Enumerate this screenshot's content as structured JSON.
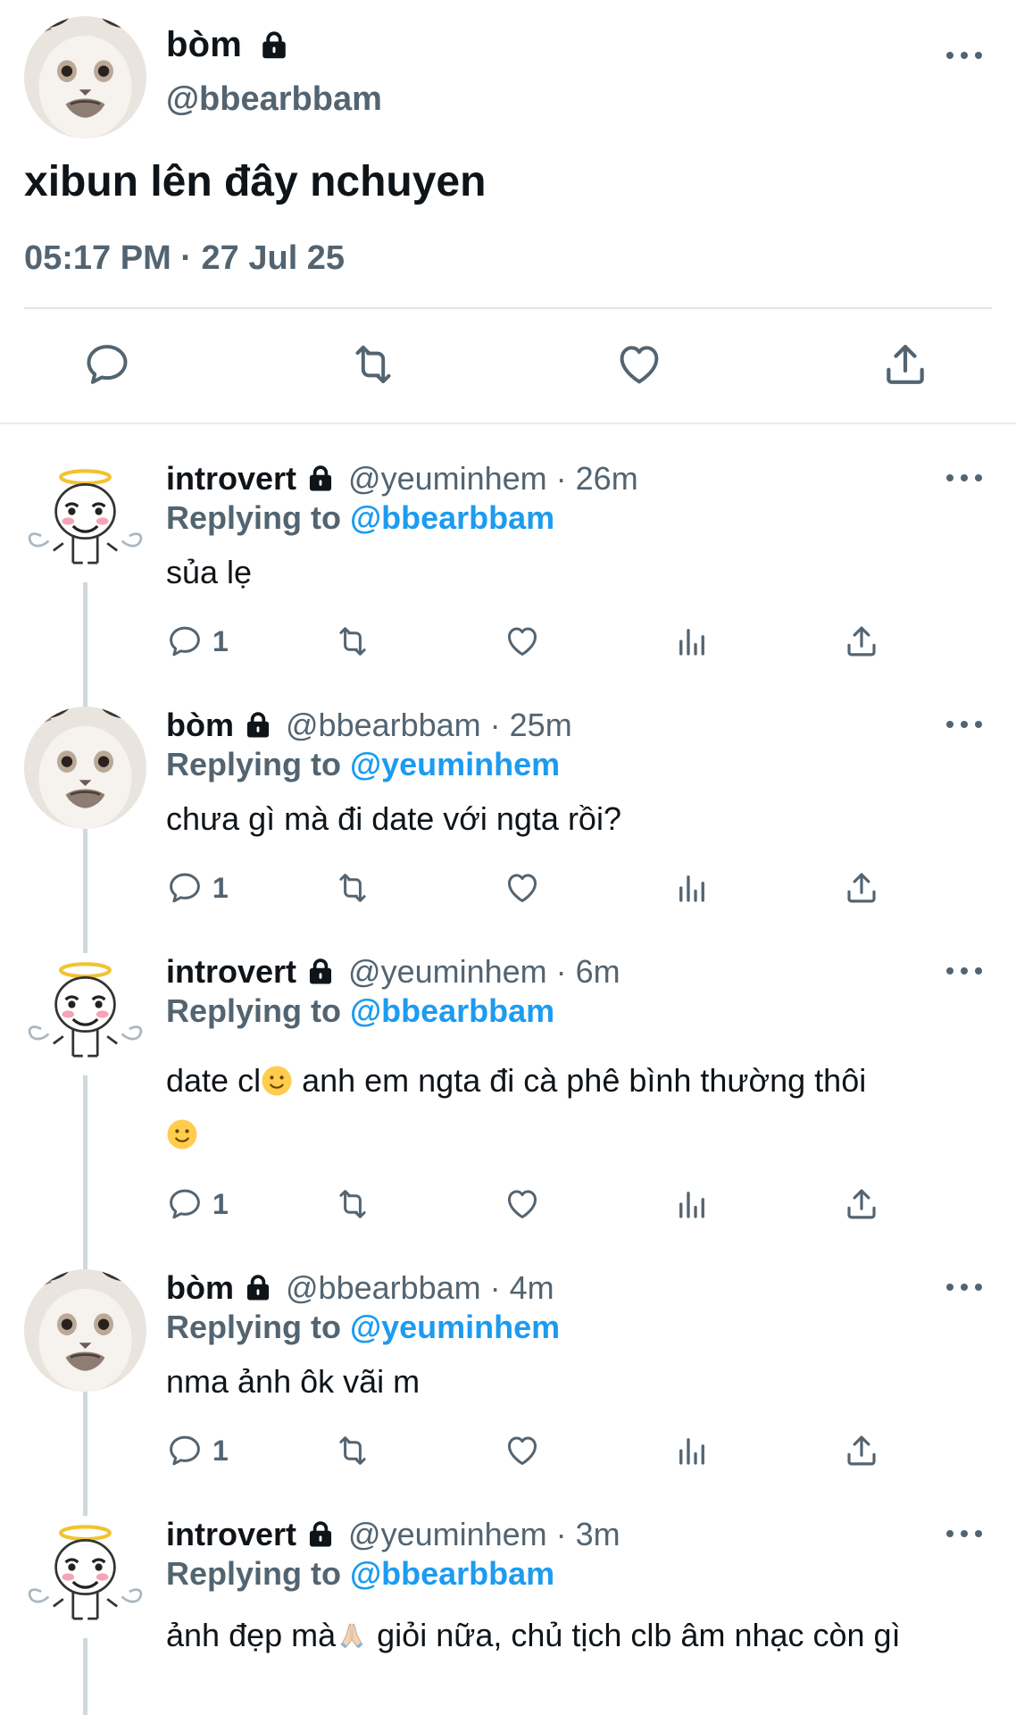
{
  "main": {
    "name": "bòm",
    "handle": "@bbearbbam",
    "text": "xibun lên đây nchuyen",
    "timestamp": "05:17 PM · 27 Jul 25"
  },
  "replies": [
    {
      "name": "introvert",
      "meta": "@yeuminhem · 26m",
      "replying_label": "Replying to",
      "replying_to": "@bbearbbam",
      "text": "sủa lẹ",
      "reply_count": "1"
    },
    {
      "name": "bòm",
      "meta": "@bbearbbam · 25m",
      "replying_label": "Replying to",
      "replying_to": "@yeuminhem",
      "text": "chưa gì mà đi date với ngta rồi?",
      "reply_count": "1"
    },
    {
      "name": "introvert",
      "meta": "@yeuminhem · 6m",
      "replying_label": "Replying to",
      "replying_to": "@bbearbbam",
      "text_a": "date cl",
      "text_b": " anh em ngta đi cà phê bình thường thôi",
      "reply_count": "1"
    },
    {
      "name": "bòm",
      "meta": "@bbearbbam · 4m",
      "replying_label": "Replying to",
      "replying_to": "@yeuminhem",
      "text": "nma ảnh ôk vãi m",
      "reply_count": "1"
    },
    {
      "name": "introvert",
      "meta": "@yeuminhem · 3m",
      "replying_label": "Replying to",
      "replying_to": "@bbearbbam",
      "text_a": "ảnh đẹp mà",
      "text_b": " giỏi nữa, chủ tịch clb âm nhạc còn gì"
    }
  ],
  "icons": {
    "reply": "comment-icon",
    "retweet": "retweet-icon",
    "like": "heart-icon",
    "views": "analytics-icon",
    "share": "share-icon",
    "lock": "lock-icon",
    "more": "more-icon"
  },
  "colors": {
    "text": "#0f1419",
    "muted": "#536471",
    "link": "#1d9bf0"
  }
}
